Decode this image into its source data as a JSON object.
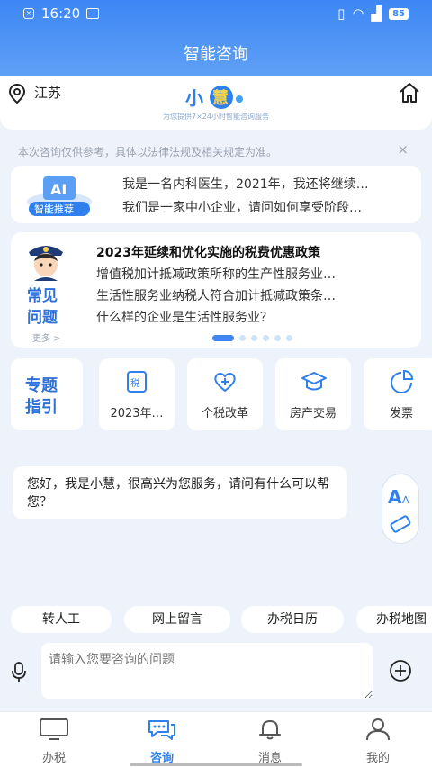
{
  "status_bar": {
    "time": "16:20",
    "battery": "85"
  },
  "header": {
    "title": "智能咨询"
  },
  "location": {
    "region": "江苏"
  },
  "logo": {
    "text": "小慧",
    "slogan": "为您提供7×24小时智能咨询服务"
  },
  "notice": {
    "text": "本次咨询仅供参考，具体以法律法规及相关规定为准。",
    "close": "×"
  },
  "recommend": {
    "badge": "智能推荐",
    "questions": [
      "我是一名内科医生，2021年，我还将继续…",
      "我们是一家中小企业，请问如何享受阶段…"
    ]
  },
  "faq": {
    "label_line1": "常见",
    "label_line2": "问题",
    "more": "更多 >",
    "title": "2023年延续和优化实施的税费优惠政策",
    "items": [
      "增值税加计抵减政策所称的生产性服务业…",
      "生活性服务业纳税人符合加计抵减政策条…",
      "什么样的企业是生活性服务业？"
    ],
    "pages": 6,
    "active_page": 0
  },
  "topics": {
    "lead_line1": "专题",
    "lead_line2": "指引",
    "items": [
      {
        "label": "2023年…",
        "icon": "tax-document-icon"
      },
      {
        "label": "个税改革",
        "icon": "heart-plus-icon"
      },
      {
        "label": "房产交易",
        "icon": "graduation-cap-icon"
      },
      {
        "label": "发票",
        "icon": "pie-chart-icon"
      }
    ]
  },
  "chat": {
    "greeting": "您好，我是小慧，很高兴为您服务，请问有什么可以帮您？"
  },
  "quick_actions": [
    "转人工",
    "网上留言",
    "办税日历",
    "办税地图"
  ],
  "input": {
    "placeholder": "请输入您要咨询的问题"
  },
  "tabbar": {
    "items": [
      {
        "label": "办税",
        "icon": "monitor-icon"
      },
      {
        "label": "咨询",
        "icon": "chat-bubbles-icon"
      },
      {
        "label": "消息",
        "icon": "bell-icon"
      },
      {
        "label": "我的",
        "icon": "person-icon"
      }
    ],
    "active": "咨询"
  },
  "colors": {
    "primary": "#3d86f4",
    "accent": "#2e6fd8",
    "background": "#eef3fb"
  }
}
